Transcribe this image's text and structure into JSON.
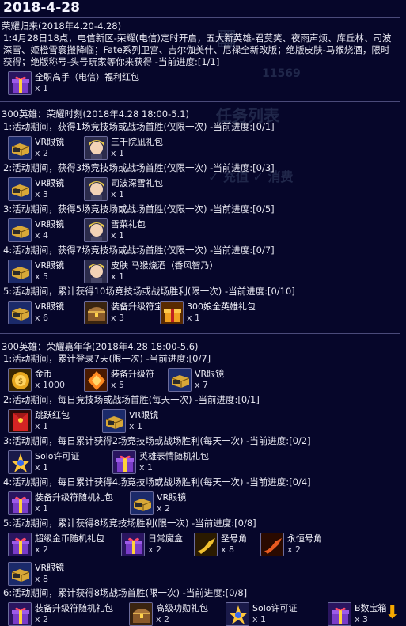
{
  "date": "2018-4-28",
  "sections": [
    {
      "title": "荣耀归来(2018年4.20-4.28)",
      "desc": "1:4月28日18点，电信新区-荣耀(电信)定时开启，五大新英雄-君莫笑、夜雨声烦、库丘林、司波深雪、姬橙雪寰搬降临；Fate系列卫宫、吉尔伽美什、尼禄全新改版；绝版皮肤-马猴烧酒，限时获得；绝版称号-头号玩家等你来获得 -当前进度:[1/1]",
      "items": [
        {
          "name": "全职高手（电信）福利红包",
          "qty": "x 1",
          "icon": "gift-box-icon"
        }
      ]
    },
    {
      "title": "300英雄：荣耀时刻(2018年4.28 18:00-5.1)",
      "tasks": [
        {
          "text": "1:活动期间，获得1场竞技场或战场首胜(仅限一次) -当前进度:[0/1]",
          "items": [
            {
              "name": "VR眼镜",
              "qty": "x 2",
              "icon": "vr-glasses-icon"
            },
            {
              "name": "三千院凪礼包",
              "qty": "x 1",
              "icon": "hero-portrait-icon"
            }
          ]
        },
        {
          "text": "2:活动期间，获得3场竞技场或战场首胜(仅限一次) -当前进度:[0/3]",
          "items": [
            {
              "name": "VR眼镜",
              "qty": "x 3",
              "icon": "vr-glasses-icon"
            },
            {
              "name": "司波深雪礼包",
              "qty": "x 1",
              "icon": "hero-portrait-icon"
            }
          ]
        },
        {
          "text": "3:活动期间，获得5场竞技场或战场首胜(仅限一次) -当前进度:[0/5]",
          "items": [
            {
              "name": "VR眼镜",
              "qty": "x 4",
              "icon": "vr-glasses-icon"
            },
            {
              "name": "雪菜礼包",
              "qty": "x 1",
              "icon": "hero-portrait-icon"
            }
          ]
        },
        {
          "text": "4:活动期间，获得7场竞技场或战场首胜(仅限一次) -当前进度:[0/7]",
          "items": [
            {
              "name": "VR眼镜",
              "qty": "x 5",
              "icon": "vr-glasses-icon"
            },
            {
              "name": "皮肤 马猴烧酒（香风智乃）",
              "qty": "x 1",
              "icon": "hero-portrait-icon"
            }
          ]
        },
        {
          "text": "5:活动期间，累计获得10场竞技场或战场胜利(限一次) -当前进度:[0/10]",
          "items": [
            {
              "name": "VR眼镜",
              "qty": "x 6",
              "icon": "vr-glasses-icon"
            },
            {
              "name": "装备升级符宝箱",
              "qty": "x 3",
              "icon": "treasure-chest-icon"
            },
            {
              "name": "300娘全英雄礼包",
              "qty": "x 1",
              "icon": "golden-gift-icon"
            }
          ]
        }
      ]
    },
    {
      "title": "300英雄：荣耀嘉年华(2018年4.28 18:00-5.6)",
      "tasks": [
        {
          "text": "1:活动期间，累计登录7天(限一次) -当前进度:[0/7]",
          "items": [
            {
              "name": "金币",
              "qty": "x 1000",
              "icon": "gold-coin-icon"
            },
            {
              "name": "装备升级符",
              "qty": "x 5",
              "icon": "upgrade-rune-icon"
            },
            {
              "name": "VR眼镜",
              "qty": "x 7",
              "icon": "vr-glasses-icon"
            }
          ]
        },
        {
          "text": "2:活动期间，每日竞技场或战场首胜(每天一次) -当前进度:[0/1]",
          "items": [
            {
              "name": "跳跃红包",
              "qty": "x 1",
              "icon": "red-envelope-icon"
            },
            {
              "name": "VR眼镜",
              "qty": "x 1",
              "icon": "vr-glasses-icon"
            }
          ]
        },
        {
          "text": "3:活动期间，每日累计获得2场竞技场或战场胜利(每天一次) -当前进度:[0/2]",
          "items": [
            {
              "name": "Solo许可证",
              "qty": "x 1",
              "icon": "solo-license-icon"
            },
            {
              "name": "英雄表情随机礼包",
              "qty": "x 1",
              "icon": "gift-box-icon"
            }
          ]
        },
        {
          "text": "4:活动期间，每日累计获得4场竞技场或战场胜利(每天一次) -当前进度:[0/4]",
          "items": [
            {
              "name": "装备升级符随机礼包",
              "qty": "x 1",
              "icon": "gift-box-icon"
            },
            {
              "name": "VR眼镜",
              "qty": "x 2",
              "icon": "vr-glasses-icon"
            }
          ]
        },
        {
          "text": "5:活动期间，累计获得8场竞技场胜利(限一次) -当前进度:[0/8]",
          "items": [
            {
              "name": "超级金币随机礼包",
              "qty": "x 2",
              "icon": "gift-box-icon"
            },
            {
              "name": "日常魔盒",
              "qty": "x 2",
              "icon": "gift-box-icon"
            },
            {
              "name": "圣号角",
              "qty": "x 8",
              "icon": "golden-horn-icon"
            },
            {
              "name": "永恒号角",
              "qty": "x 2",
              "icon": "red-horn-icon"
            },
            {
              "name": "VR眼镜",
              "qty": "x 8",
              "icon": "vr-glasses-icon"
            }
          ]
        },
        {
          "text": "6:活动期间，累计获得8场战场首胜(限一次) -当前进度:[0/8]",
          "items": [
            {
              "name": "装备升级符随机礼包",
              "qty": "x 2",
              "icon": "gift-box-icon"
            },
            {
              "name": "高级功勋礼包",
              "qty": "x 2",
              "icon": "treasure-chest-icon"
            },
            {
              "name": "Solo许可证",
              "qty": "x 1",
              "icon": "solo-license-icon"
            },
            {
              "name": "B数宝箱",
              "qty": "x 3",
              "icon": "gift-box-icon"
            }
          ]
        }
      ]
    }
  ],
  "scroll_icon": "down-arrow-icon",
  "colors": {
    "background": "#06062a",
    "text": "#e8e8f2",
    "separator": "#4a4a7a",
    "accent_arrow": "#f5a800"
  }
}
